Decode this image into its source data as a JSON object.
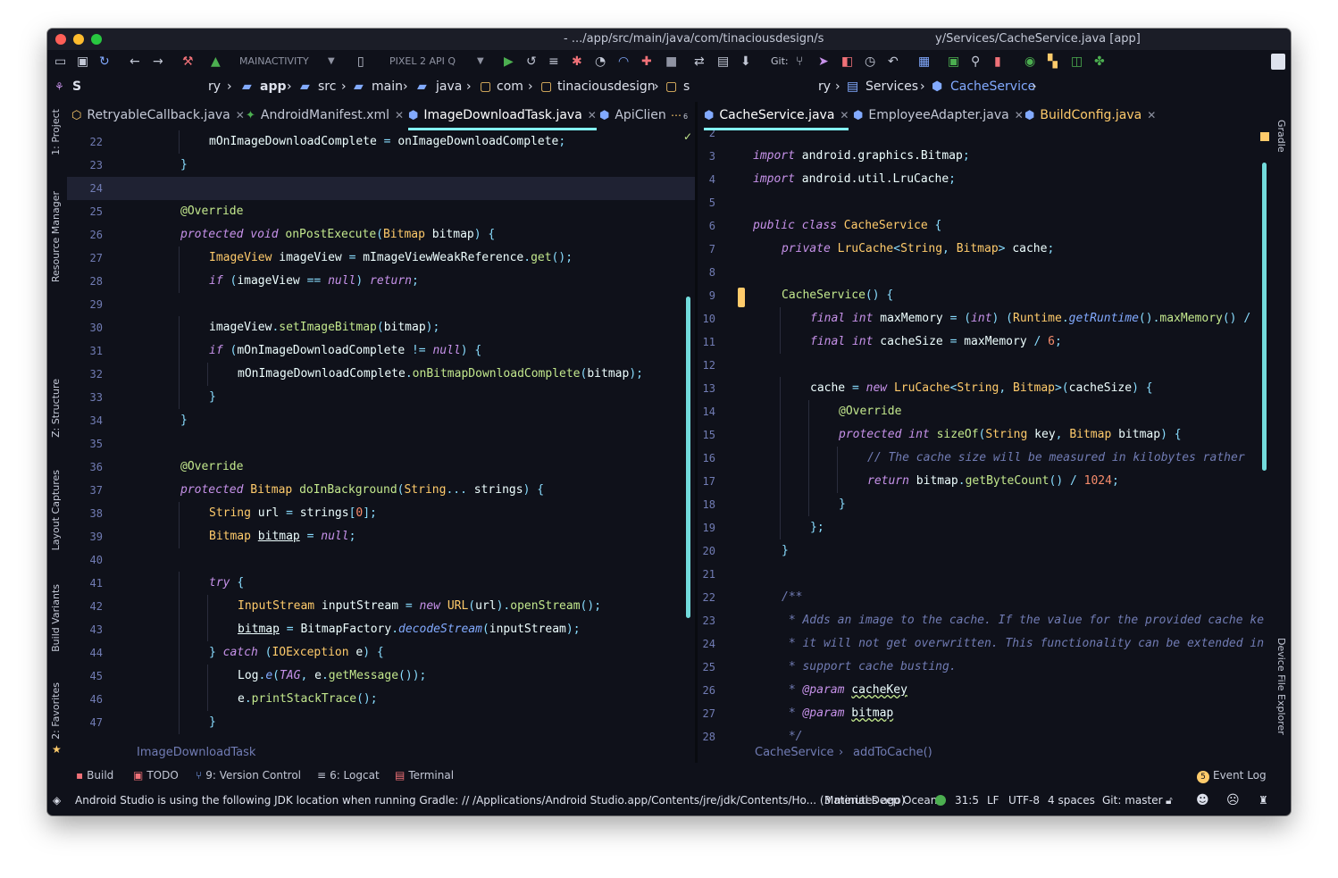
{
  "window": {
    "title_left": "- .../app/src/main/java/com/tinaciousdesign/s",
    "title_right": "y/Services/CacheService.java [app]"
  },
  "toolbar": {
    "run_config": "MAINACTIVITY",
    "device": "PIXEL 2 API Q",
    "git_label": "Git:"
  },
  "breadcrumbs": {
    "root": "S",
    "items": [
      "ry",
      "app",
      "src",
      "main",
      "java",
      "com",
      "tinaciousdesign",
      "s"
    ],
    "right_items": [
      "ry",
      "Services",
      "CacheService"
    ]
  },
  "left_tabs": [
    {
      "label": "RetryableCallback.java"
    },
    {
      "label": "AndroidManifest.xml"
    },
    {
      "label": "ImageDownloadTask.java"
    },
    {
      "label": "ApiClien"
    }
  ],
  "left_tabs_overflow": "6",
  "right_tabs": [
    {
      "label": "CacheService.java"
    },
    {
      "label": "EmployeeAdapter.java"
    },
    {
      "label": "BuildConfig.java"
    }
  ],
  "side_panels_left": [
    "1: Project",
    "Resource Manager",
    "Z: Structure",
    "Layout Captures",
    "Build Variants",
    "2: Favorites"
  ],
  "side_panels_right": [
    "Gradle",
    "Device File Explorer"
  ],
  "left_editor": {
    "breadcrumb": "ImageDownloadTask",
    "lines": [
      {
        "n": "22",
        "i": 2,
        "t": [
          [
            "mOnImageDownloadComplete ",
            ""
          ],
          [
            "= ",
            "o"
          ],
          [
            "onImageDownloadComplete",
            ""
          ],
          [
            ";",
            "o"
          ]
        ]
      },
      {
        "n": "23",
        "i": 1,
        "t": [
          [
            "}",
            "o"
          ]
        ]
      },
      {
        "n": "24",
        "i": 0,
        "t": []
      },
      {
        "n": "25",
        "i": 1,
        "t": [
          [
            "@Override",
            "m"
          ]
        ]
      },
      {
        "n": "26",
        "i": 1,
        "t": [
          [
            "protected void ",
            "k"
          ],
          [
            "onPostExecute",
            "m"
          ],
          [
            "(",
            "o"
          ],
          [
            "Bitmap ",
            "t"
          ],
          [
            "bitmap",
            ""
          ],
          [
            ") {",
            "o"
          ]
        ]
      },
      {
        "n": "27",
        "i": 2,
        "t": [
          [
            "ImageView ",
            "t"
          ],
          [
            "imageView ",
            ""
          ],
          [
            "= ",
            "o"
          ],
          [
            "mImageViewWeakReference",
            ""
          ],
          [
            ".",
            "o"
          ],
          [
            "get",
            "m"
          ],
          [
            "();",
            "o"
          ]
        ]
      },
      {
        "n": "28",
        "i": 2,
        "t": [
          [
            "if ",
            "k"
          ],
          [
            "(",
            "o"
          ],
          [
            "imageView ",
            ""
          ],
          [
            "== ",
            "o"
          ],
          [
            "null",
            "k"
          ],
          [
            ") ",
            "o"
          ],
          [
            "return",
            "k"
          ],
          [
            ";",
            "o"
          ]
        ]
      },
      {
        "n": "29",
        "i": 0,
        "t": []
      },
      {
        "n": "30",
        "i": 2,
        "t": [
          [
            "imageView",
            ""
          ],
          [
            ".",
            "o"
          ],
          [
            "setImageBitmap",
            "m"
          ],
          [
            "(",
            "o"
          ],
          [
            "bitmap",
            ""
          ],
          [
            ");",
            "o"
          ]
        ]
      },
      {
        "n": "31",
        "i": 2,
        "t": [
          [
            "if ",
            "k"
          ],
          [
            "(",
            "o"
          ],
          [
            "mOnImageDownloadComplete ",
            ""
          ],
          [
            "!= ",
            "o"
          ],
          [
            "null",
            "k"
          ],
          [
            ") {",
            "o"
          ]
        ]
      },
      {
        "n": "32",
        "i": 3,
        "t": [
          [
            "mOnImageDownloadComplete",
            ""
          ],
          [
            ".",
            "o"
          ],
          [
            "onBitmapDownloadComplete",
            "m"
          ],
          [
            "(",
            "o"
          ],
          [
            "bitmap",
            ""
          ],
          [
            ");",
            "o"
          ]
        ]
      },
      {
        "n": "33",
        "i": 2,
        "t": [
          [
            "}",
            "o"
          ]
        ]
      },
      {
        "n": "34",
        "i": 1,
        "t": [
          [
            "}",
            "o"
          ]
        ]
      },
      {
        "n": "35",
        "i": 0,
        "t": []
      },
      {
        "n": "36",
        "i": 1,
        "t": [
          [
            "@Override",
            "m"
          ]
        ]
      },
      {
        "n": "37",
        "i": 1,
        "t": [
          [
            "protected ",
            "k"
          ],
          [
            "Bitmap ",
            "t"
          ],
          [
            "doInBackground",
            "m"
          ],
          [
            "(",
            "o"
          ],
          [
            "String",
            "t"
          ],
          [
            "... ",
            "o"
          ],
          [
            "strings",
            ""
          ],
          [
            ") {",
            "o"
          ]
        ]
      },
      {
        "n": "38",
        "i": 2,
        "t": [
          [
            "String ",
            "t"
          ],
          [
            "url ",
            ""
          ],
          [
            "= ",
            "o"
          ],
          [
            "strings",
            ""
          ],
          [
            "[",
            "o"
          ],
          [
            "0",
            "n"
          ],
          [
            "];",
            "o"
          ]
        ]
      },
      {
        "n": "39",
        "i": 2,
        "t": [
          [
            "Bitmap ",
            "t"
          ],
          [
            "bitmap",
            "u"
          ],
          [
            " = ",
            "o"
          ],
          [
            "null",
            "k"
          ],
          [
            ";",
            "o"
          ]
        ]
      },
      {
        "n": "40",
        "i": 0,
        "t": []
      },
      {
        "n": "41",
        "i": 2,
        "t": [
          [
            "try ",
            "k"
          ],
          [
            "{",
            "o"
          ]
        ]
      },
      {
        "n": "42",
        "i": 3,
        "t": [
          [
            "InputStream ",
            "t"
          ],
          [
            "inputStream ",
            ""
          ],
          [
            "= ",
            "o"
          ],
          [
            "new ",
            "k"
          ],
          [
            "URL",
            "t"
          ],
          [
            "(",
            "o"
          ],
          [
            "url",
            ""
          ],
          [
            ").",
            "o"
          ],
          [
            "openStream",
            "m"
          ],
          [
            "();",
            "o"
          ]
        ]
      },
      {
        "n": "43",
        "i": 3,
        "t": [
          [
            "bitmap",
            "u"
          ],
          [
            " = ",
            "o"
          ],
          [
            "BitmapFactory",
            ""
          ],
          [
            ".",
            "o"
          ],
          [
            "decodeStream",
            "fi"
          ],
          [
            "(",
            "o"
          ],
          [
            "inputStream",
            ""
          ],
          [
            ");",
            "o"
          ]
        ]
      },
      {
        "n": "44",
        "i": 2,
        "t": [
          [
            "} ",
            "o"
          ],
          [
            "catch ",
            "k"
          ],
          [
            "(",
            "o"
          ],
          [
            "IOException ",
            "t"
          ],
          [
            "e",
            ""
          ],
          [
            ") {",
            "o"
          ]
        ]
      },
      {
        "n": "45",
        "i": 3,
        "t": [
          [
            "Log",
            ""
          ],
          [
            ".",
            "o"
          ],
          [
            "e",
            "fi"
          ],
          [
            "(",
            "o"
          ],
          [
            "TAG",
            "dt"
          ],
          [
            ", ",
            "o"
          ],
          [
            "e",
            ""
          ],
          [
            ".",
            "o"
          ],
          [
            "getMessage",
            "m"
          ],
          [
            "());",
            "o"
          ]
        ]
      },
      {
        "n": "46",
        "i": 3,
        "t": [
          [
            "e",
            ""
          ],
          [
            ".",
            "o"
          ],
          [
            "printStackTrace",
            "m"
          ],
          [
            "();",
            "o"
          ]
        ]
      },
      {
        "n": "47",
        "i": 2,
        "t": [
          [
            "}",
            "o"
          ]
        ]
      }
    ]
  },
  "right_editor": {
    "breadcrumb": "CacheService",
    "breadcrumb_sep": "›",
    "breadcrumb_method": "addToCache()",
    "lines": [
      {
        "n": "2",
        "i": 0,
        "t": []
      },
      {
        "n": "3",
        "i": 0,
        "t": [
          [
            "import ",
            "k"
          ],
          [
            "android.graphics.Bitmap",
            ""
          ],
          [
            ";",
            "o"
          ]
        ]
      },
      {
        "n": "4",
        "i": 0,
        "t": [
          [
            "import ",
            "k"
          ],
          [
            "android.util.LruCache",
            ""
          ],
          [
            ";",
            "o"
          ]
        ]
      },
      {
        "n": "5",
        "i": 0,
        "t": []
      },
      {
        "n": "6",
        "i": 0,
        "t": [
          [
            "public class ",
            "k"
          ],
          [
            "CacheService ",
            "t"
          ],
          [
            "{",
            "o"
          ]
        ]
      },
      {
        "n": "7",
        "i": 1,
        "t": [
          [
            "private ",
            "k"
          ],
          [
            "LruCache",
            "t"
          ],
          [
            "<",
            "o"
          ],
          [
            "String",
            "t"
          ],
          [
            ", ",
            "o"
          ],
          [
            "Bitmap",
            "t"
          ],
          [
            "> ",
            "o"
          ],
          [
            "cache",
            ""
          ],
          [
            ";",
            "o"
          ]
        ]
      },
      {
        "n": "8",
        "i": 0,
        "t": []
      },
      {
        "n": "9",
        "i": 1,
        "t": [
          [
            "CacheService",
            "m"
          ],
          [
            "() {",
            "o"
          ]
        ]
      },
      {
        "n": "10",
        "i": 2,
        "t": [
          [
            "final int ",
            "k"
          ],
          [
            "maxMemory ",
            ""
          ],
          [
            "= (",
            "o"
          ],
          [
            "int",
            "k"
          ],
          [
            ") (",
            "o"
          ],
          [
            "Runtime",
            "t"
          ],
          [
            ".",
            "o"
          ],
          [
            "getRuntime",
            "fi"
          ],
          [
            "().",
            "o"
          ],
          [
            "maxMemory",
            "m"
          ],
          [
            "() /",
            "o"
          ]
        ]
      },
      {
        "n": "11",
        "i": 2,
        "t": [
          [
            "final int ",
            "k"
          ],
          [
            "cacheSize ",
            ""
          ],
          [
            "= ",
            "o"
          ],
          [
            "maxMemory ",
            ""
          ],
          [
            "/ ",
            "o"
          ],
          [
            "6",
            "n"
          ],
          [
            ";",
            "o"
          ]
        ]
      },
      {
        "n": "12",
        "i": 0,
        "t": []
      },
      {
        "n": "13",
        "i": 2,
        "t": [
          [
            "cache ",
            ""
          ],
          [
            "= ",
            "o"
          ],
          [
            "new ",
            "k"
          ],
          [
            "LruCache",
            "t"
          ],
          [
            "<",
            "o"
          ],
          [
            "String",
            "t"
          ],
          [
            ", ",
            "o"
          ],
          [
            "Bitmap",
            "t"
          ],
          [
            ">(",
            "o"
          ],
          [
            "cacheSize",
            ""
          ],
          [
            ") {",
            "o"
          ]
        ]
      },
      {
        "n": "14",
        "i": 3,
        "t": [
          [
            "@Override",
            "m"
          ]
        ]
      },
      {
        "n": "15",
        "i": 3,
        "t": [
          [
            "protected int ",
            "k"
          ],
          [
            "sizeOf",
            "m"
          ],
          [
            "(",
            "o"
          ],
          [
            "String ",
            "t"
          ],
          [
            "key",
            ""
          ],
          [
            ", ",
            "o"
          ],
          [
            "Bitmap ",
            "t"
          ],
          [
            "bitmap",
            ""
          ],
          [
            ") {",
            "o"
          ]
        ]
      },
      {
        "n": "16",
        "i": 4,
        "t": [
          [
            "// The cache size will be measured in kilobytes rather",
            "c"
          ]
        ]
      },
      {
        "n": "17",
        "i": 4,
        "t": [
          [
            "return ",
            "k"
          ],
          [
            "bitmap",
            ""
          ],
          [
            ".",
            "o"
          ],
          [
            "getByteCount",
            "m"
          ],
          [
            "() / ",
            "o"
          ],
          [
            "1024",
            "n"
          ],
          [
            ";",
            "o"
          ]
        ]
      },
      {
        "n": "18",
        "i": 3,
        "t": [
          [
            "}",
            "o"
          ]
        ]
      },
      {
        "n": "19",
        "i": 2,
        "t": [
          [
            "};",
            "o"
          ]
        ]
      },
      {
        "n": "20",
        "i": 1,
        "t": [
          [
            "}",
            "o"
          ]
        ]
      },
      {
        "n": "21",
        "i": 0,
        "t": []
      },
      {
        "n": "22",
        "i": 1,
        "t": [
          [
            "/**",
            "c"
          ]
        ]
      },
      {
        "n": "23",
        "i": 1,
        "t": [
          [
            " * Adds an image to the cache. If the value for the provided cache ke",
            "c"
          ]
        ]
      },
      {
        "n": "24",
        "i": 1,
        "t": [
          [
            " * it will not get overwritten. This functionality can be extended in",
            "c"
          ]
        ]
      },
      {
        "n": "25",
        "i": 1,
        "t": [
          [
            " * support cache busting.",
            "c"
          ]
        ]
      },
      {
        "n": "26",
        "i": 1,
        "t": [
          [
            " * ",
            "c"
          ],
          [
            "@param ",
            "dt"
          ],
          [
            "cacheKey",
            "wavy"
          ]
        ]
      },
      {
        "n": "27",
        "i": 1,
        "t": [
          [
            " * ",
            "c"
          ],
          [
            "@param ",
            "dt"
          ],
          [
            "bitmap",
            "wavy"
          ]
        ]
      },
      {
        "n": "28",
        "i": 1,
        "t": [
          [
            " */",
            "c"
          ]
        ]
      }
    ]
  },
  "tool_windows": [
    {
      "label": "Build"
    },
    {
      "label": "TODO"
    },
    {
      "label": "9: Version Control"
    },
    {
      "label": "6: Logcat"
    },
    {
      "label": "Terminal"
    }
  ],
  "event_log": {
    "badge": "5",
    "label": "Event Log"
  },
  "status": {
    "message": "Android Studio is using the following JDK location when running Gradle: // /Applications/Android Studio.app/Contents/jre/jdk/Contents/Ho... (3 minutes ago)",
    "theme": "Material Deep Ocean",
    "position": "31:5",
    "line_sep": "LF",
    "encoding": "UTF-8",
    "indent": "4 spaces",
    "git": "Git: master"
  },
  "colors": {
    "background": "#0f111a",
    "accent": "#84ffff",
    "keyword": "#c792ea",
    "type": "#ffcb6b",
    "method": "#c3e88d",
    "function": "#82aaff",
    "number": "#f78c6c",
    "comment": "#717cb4"
  }
}
